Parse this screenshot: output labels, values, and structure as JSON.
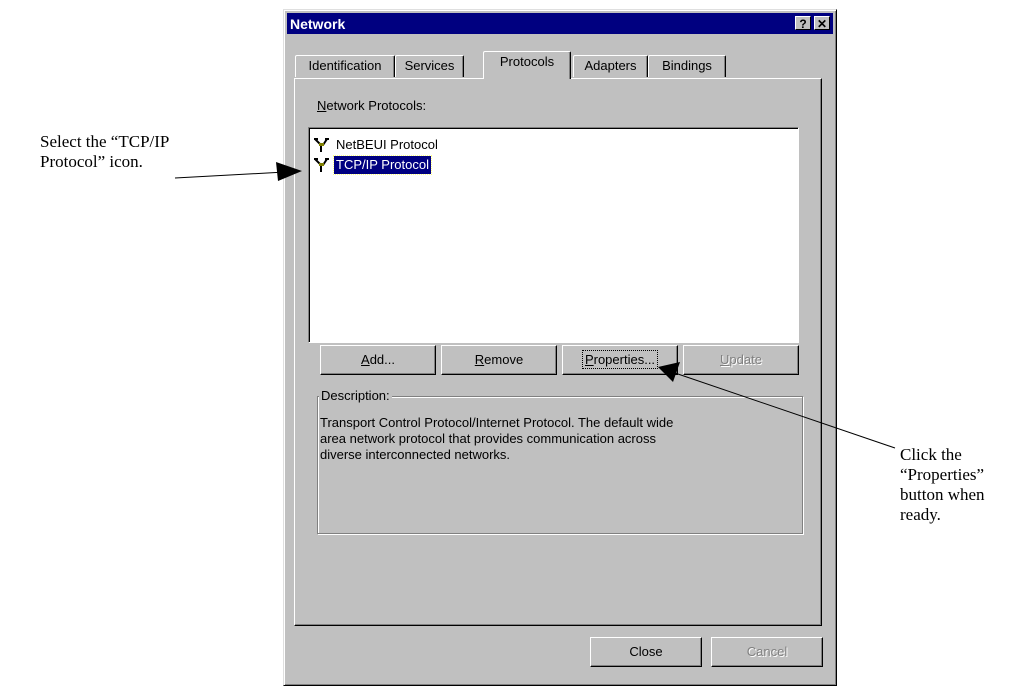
{
  "annotations": {
    "left": [
      "Select the “TCP/IP",
      "Protocol” icon."
    ],
    "right": [
      "Click the",
      "“Properties”",
      "button when",
      "ready."
    ]
  },
  "dialog": {
    "title": "Network",
    "help_label": "?",
    "close_label": "✕",
    "tabs": [
      "Identification",
      "Services",
      "Protocols",
      "Adapters",
      "Bindings"
    ],
    "active_tab": "Protocols",
    "list_label": {
      "underlined": "N",
      "rest": "etwork Protocols:"
    },
    "protocols": [
      {
        "name": "NetBEUI Protocol",
        "selected": false,
        "icon": "network-protocol-icon"
      },
      {
        "name": "TCP/IP Protocol",
        "selected": true,
        "icon": "network-protocol-icon"
      }
    ],
    "buttons": {
      "add": {
        "underlined": "A",
        "rest": "dd..."
      },
      "remove": {
        "underlined": "R",
        "rest": "emove"
      },
      "properties": {
        "underlined": "P",
        "rest": "roperties..."
      },
      "update": {
        "underlined": "U",
        "rest": "pdate"
      }
    },
    "description_label": "Description:",
    "description_lines": [
      "Transport Control Protocol/Internet Protocol. The default wide",
      "area network protocol that provides communication across",
      "diverse interconnected networks."
    ],
    "close_button": "Close",
    "cancel_button": "Cancel"
  },
  "colors": {
    "titlebar": "#000080",
    "face": "#c0c0c0",
    "selection": "#000080"
  }
}
